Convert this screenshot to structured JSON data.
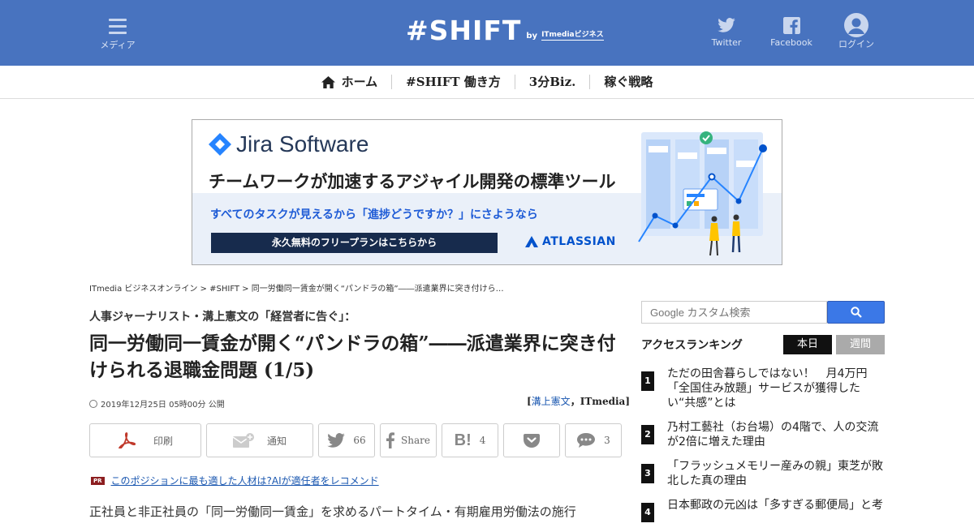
{
  "header": {
    "menu_label": "メディア",
    "logo": "#SHIFT",
    "logo_by": "by",
    "logo_publisher": "ITmediaビジネス",
    "twitter_label": "Twitter",
    "facebook_label": "Facebook",
    "login_label": "ログイン",
    "bg_color": "#4873bf"
  },
  "nav": {
    "items": [
      {
        "label": "ホーム",
        "icon": "home-icon"
      },
      {
        "label": "#SHIFT 働き方"
      },
      {
        "label": "3分Biz."
      },
      {
        "label": "稼ぐ戦略"
      }
    ]
  },
  "ad": {
    "brand": "Jira Software",
    "tagline": "チームワークが加速するアジャイル開発の標準ツール",
    "subline": "すべてのタスクが見えるから「進捗どうですか？」にさようなら",
    "cta": "永久無料のフリープランはこちらから",
    "company": "ATLASSIAN"
  },
  "breadcrumb": "ITmedia ビジネスオンライン > #SHIFT > 同一労働同一賃金が開く“パンドラの箱”――派遣業界に突き付けら…",
  "article": {
    "kicker": "人事ジャーナリスト・溝上憲文の「経営者に告ぐ」：",
    "title": "同一労働同一賃金が開く“パンドラの箱”――派遣業界に突き付けられる退職金問題 (1/5)",
    "date": "2019年12月25日 05時00分 公開",
    "author": "溝上憲文",
    "publisher": "ITmedia",
    "pr_badge": "PR",
    "pr_link": "このポジションに最も適した人材は?AIが適任者をレコメンド",
    "body_start": "正社員と非正社員の「同一労働同一賃金」を求めるパートタイム・有期雇用労働法の施行"
  },
  "share": {
    "print": "印刷",
    "notify": "通知",
    "twitter_count": "66",
    "facebook": "Share",
    "hatena_count": "4",
    "comment_count": "3"
  },
  "sidebar": {
    "search_placeholder": "Google カスタム検索",
    "ranking_title": "アクセスランキング",
    "tab_today": "本日",
    "tab_week": "週間",
    "ranking": [
      {
        "num": "1",
        "text": "ただの田舎暮らしではない！　月4万円「全国住み放題」サービスが獲得したい“共感”とは"
      },
      {
        "num": "2",
        "text": "乃村工藝社（お台場）の4階で、人の交流が2倍に増えた理由"
      },
      {
        "num": "3",
        "text": "「フラッシュメモリー産みの親」東芝が敗北した真の理由"
      },
      {
        "num": "4",
        "text": "日本郵政の元凶は「多すぎる郵便局」と考"
      }
    ]
  }
}
